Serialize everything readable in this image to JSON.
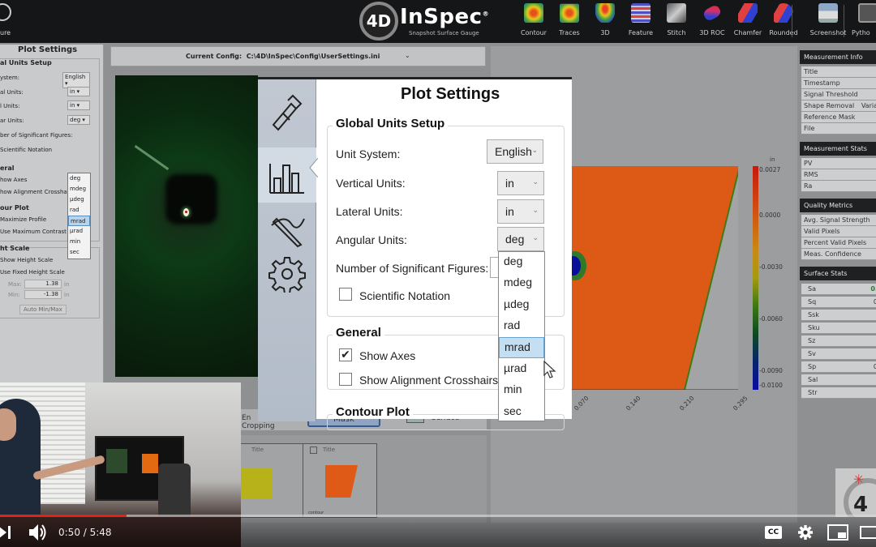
{
  "toolbar": {
    "left_partial_label": "ure",
    "logo": {
      "badge": "4D",
      "name": "InSpec",
      "registered": "®",
      "tagline": "Snapshot Surface Gauge"
    },
    "tools": [
      {
        "label": "Contour",
        "icon": "contour-icon"
      },
      {
        "label": "Traces",
        "icon": "traces-icon"
      },
      {
        "label": "3D",
        "icon": "3d-icon"
      },
      {
        "label": "Feature",
        "icon": "feature-icon"
      },
      {
        "label": "Stitch",
        "icon": "stitch-icon"
      },
      {
        "label": "3D ROC",
        "icon": "3d-roc-icon"
      },
      {
        "label": "Chamfer",
        "icon": "chamfer-icon"
      },
      {
        "label": "Rounded",
        "icon": "rounded-icon"
      },
      {
        "label": "Screenshot",
        "icon": "screenshot-icon"
      },
      {
        "label": "Pytho",
        "icon": "python-icon"
      }
    ]
  },
  "config": {
    "label": "Current Config:",
    "path": "C:\\4D\\InSpec\\Config\\UserSettings.ini"
  },
  "left_panel": {
    "title": "Plot Settings",
    "global_units": "al Units Setup",
    "unit_system_label": "ystem:",
    "unit_system": "English",
    "vertical_label": "al Units:",
    "vertical": "in",
    "lateral_label": "l Units:",
    "lateral": "in",
    "angular_label": "ar Units:",
    "angular": "deg",
    "sigfig_label": "ber of Significant Figures:",
    "sci_label": "Scientific Notation",
    "general": "eral",
    "show_axes": "how Axes",
    "show_crosshairs": "how Alignment Crosshairs",
    "contour": "our Plot",
    "maximize": "Maximize Profile",
    "max_contrast": "Use Maximum Contrast",
    "height_scale": "ht Scale",
    "show_height": "Show Height Scale",
    "fixed_height": "Use Fixed Height Scale",
    "max_label": "Max:",
    "max_value": "1.38",
    "min_label": "Min:",
    "min_value": "-1.38",
    "unit": "in",
    "auto_btn": "Auto Min/Max",
    "dropdown": [
      "deg",
      "mdeg",
      "µdeg",
      "rad",
      "mrad",
      "µrad",
      "min",
      "sec"
    ]
  },
  "overlay": {
    "title": "Plot Settings",
    "global_units_title": "Global Units Setup",
    "unit_system_label": "Unit System:",
    "unit_system_value": "English",
    "vertical_units_label": "Vertical Units:",
    "vertical_units_value": "in",
    "lateral_units_label": "Lateral Units:",
    "lateral_units_value": "in",
    "angular_units_label": "Angular Units:",
    "angular_units_value": "deg",
    "sig_figs_label": "Number of Significant Figures:",
    "sci_notation_label": "Scientific Notation",
    "sci_notation_checked": false,
    "general_title": "General",
    "show_axes_label": "Show Axes",
    "show_axes_checked": true,
    "crosshairs_label": "Show Alignment Crosshairs",
    "crosshairs_checked": false,
    "contour_title": "Contour Plot",
    "angular_options": [
      "deg",
      "mdeg",
      "µdeg",
      "rad",
      "mrad",
      "µrad",
      "min",
      "sec"
    ],
    "highlighted_option": "mrad",
    "side_tabs": [
      "caliper-icon",
      "bar-chart-icon",
      "pen-curve-icon",
      "gear-icon"
    ],
    "active_tab": 1
  },
  "contour_plot": {
    "unit": "in",
    "colorbar_ticks": [
      "0.0027",
      "0.0000",
      "-0.0030",
      "-0.0060",
      "-0.0090",
      "-0.0100"
    ],
    "x_ticks": [
      "0.070",
      "0.140",
      "0.210",
      "0.295"
    ]
  },
  "stats": {
    "measurement_info": {
      "title": "Measurement Info",
      "rows": [
        "Title",
        "Timestamp",
        "Signal Threshold",
        "Shape Removal",
        "Reference Mask",
        "File"
      ],
      "shape_removal_value": "Varia"
    },
    "measurement_stats": {
      "title": "Measurement Stats",
      "rows": [
        "PV",
        "RMS",
        "Ra"
      ]
    },
    "quality_metrics": {
      "title": "Quality Metrics",
      "rows": [
        "Avg. Signal Strength",
        "Valid Pixels",
        "Percent Valid Pixels",
        "Meas. Confidence"
      ]
    },
    "surface_stats": {
      "title": "Surface Stats",
      "rows": [
        "Sa",
        "Sq",
        "Ssk",
        "Sku",
        "Sz",
        "Sv",
        "Sp",
        "Sal",
        "Str"
      ],
      "sa_value": "0.",
      "sq_value": "0",
      "sp_value": "0"
    }
  },
  "bottom_tabs": {
    "partial": "En",
    "cropping": "Cropping",
    "mask": "Mask",
    "surface": "Surface"
  },
  "thumbnails": [
    {
      "title": "Title"
    },
    {
      "title": "Title",
      "caption": "contour"
    }
  ],
  "video": {
    "current_time": "0:50",
    "duration": "5:48",
    "time_display": "0:50 / 5:48",
    "progress": 0.144,
    "cc_label": "CC"
  }
}
